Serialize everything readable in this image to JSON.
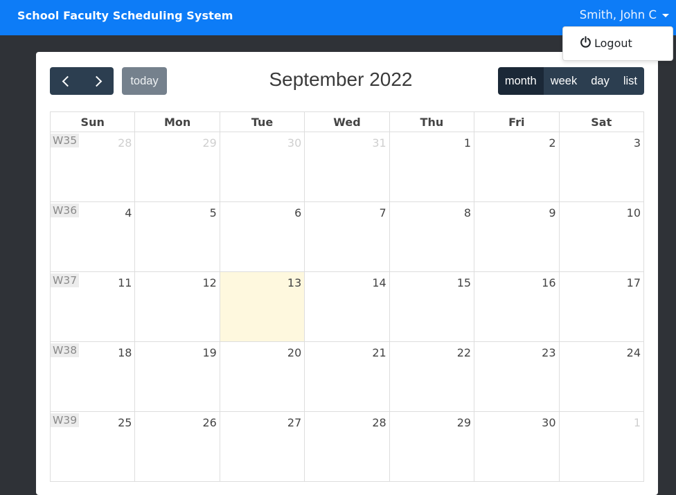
{
  "app": {
    "brand": "School Faculty Scheduling System",
    "user_name": "Smith, John C",
    "menu": {
      "logout_label": "Logout"
    }
  },
  "calendar": {
    "title": "September 2022",
    "today_label": "today",
    "views": [
      {
        "label": "month",
        "active": true
      },
      {
        "label": "week",
        "active": false
      },
      {
        "label": "day",
        "active": false
      },
      {
        "label": "list",
        "active": false
      }
    ],
    "day_headers": [
      "Sun",
      "Mon",
      "Tue",
      "Wed",
      "Thu",
      "Fri",
      "Sat"
    ],
    "weeks": [
      {
        "label": "W35",
        "days": [
          {
            "n": "28",
            "other": true
          },
          {
            "n": "29",
            "other": true
          },
          {
            "n": "30",
            "other": true
          },
          {
            "n": "31",
            "other": true
          },
          {
            "n": "1"
          },
          {
            "n": "2"
          },
          {
            "n": "3"
          }
        ]
      },
      {
        "label": "W36",
        "days": [
          {
            "n": "4"
          },
          {
            "n": "5"
          },
          {
            "n": "6"
          },
          {
            "n": "7"
          },
          {
            "n": "8"
          },
          {
            "n": "9"
          },
          {
            "n": "10"
          }
        ]
      },
      {
        "label": "W37",
        "days": [
          {
            "n": "11"
          },
          {
            "n": "12"
          },
          {
            "n": "13",
            "today": true
          },
          {
            "n": "14"
          },
          {
            "n": "15"
          },
          {
            "n": "16"
          },
          {
            "n": "17"
          }
        ]
      },
      {
        "label": "W38",
        "days": [
          {
            "n": "18"
          },
          {
            "n": "19"
          },
          {
            "n": "20"
          },
          {
            "n": "21"
          },
          {
            "n": "22"
          },
          {
            "n": "23"
          },
          {
            "n": "24"
          }
        ]
      },
      {
        "label": "W39",
        "days": [
          {
            "n": "25"
          },
          {
            "n": "26"
          },
          {
            "n": "27"
          },
          {
            "n": "28"
          },
          {
            "n": "29"
          },
          {
            "n": "30"
          },
          {
            "n": "1",
            "other": true
          }
        ]
      }
    ]
  },
  "colors": {
    "navbar": "#0d7cf7",
    "button": "#2c3e50",
    "button_active": "#1b2837",
    "today_button": "#75818d",
    "today_highlight": "#fef8de"
  }
}
